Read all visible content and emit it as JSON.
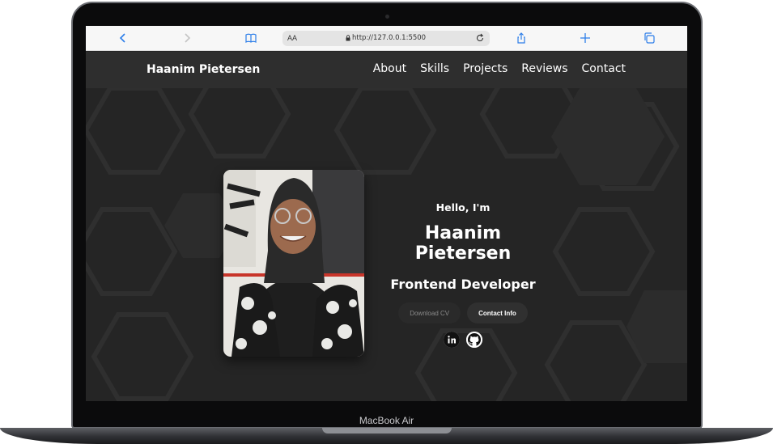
{
  "device": {
    "label": "MacBook Air"
  },
  "browser": {
    "text_size_label": "AA",
    "url": "http://127.0.0.1:5500",
    "icons": [
      "back-icon",
      "forward-icon",
      "book-icon",
      "lock-icon",
      "reload-icon",
      "share-icon",
      "plus-icon",
      "tabs-icon"
    ]
  },
  "nav": {
    "brand": "Haanim Pietersen",
    "links": [
      "About",
      "Skills",
      "Projects",
      "Reviews",
      "Contact"
    ]
  },
  "hero": {
    "greeting": "Hello, I'm",
    "name": "Haanim Pietersen",
    "role": "Frontend Developer",
    "buttons": {
      "download": "Download CV",
      "contact": "Contact Info"
    },
    "socials": [
      "linkedin-icon",
      "github-icon"
    ]
  },
  "colors": {
    "nav_bg": "#2e2e2e",
    "hero_bg": "#252525",
    "text": "#ffffff"
  }
}
